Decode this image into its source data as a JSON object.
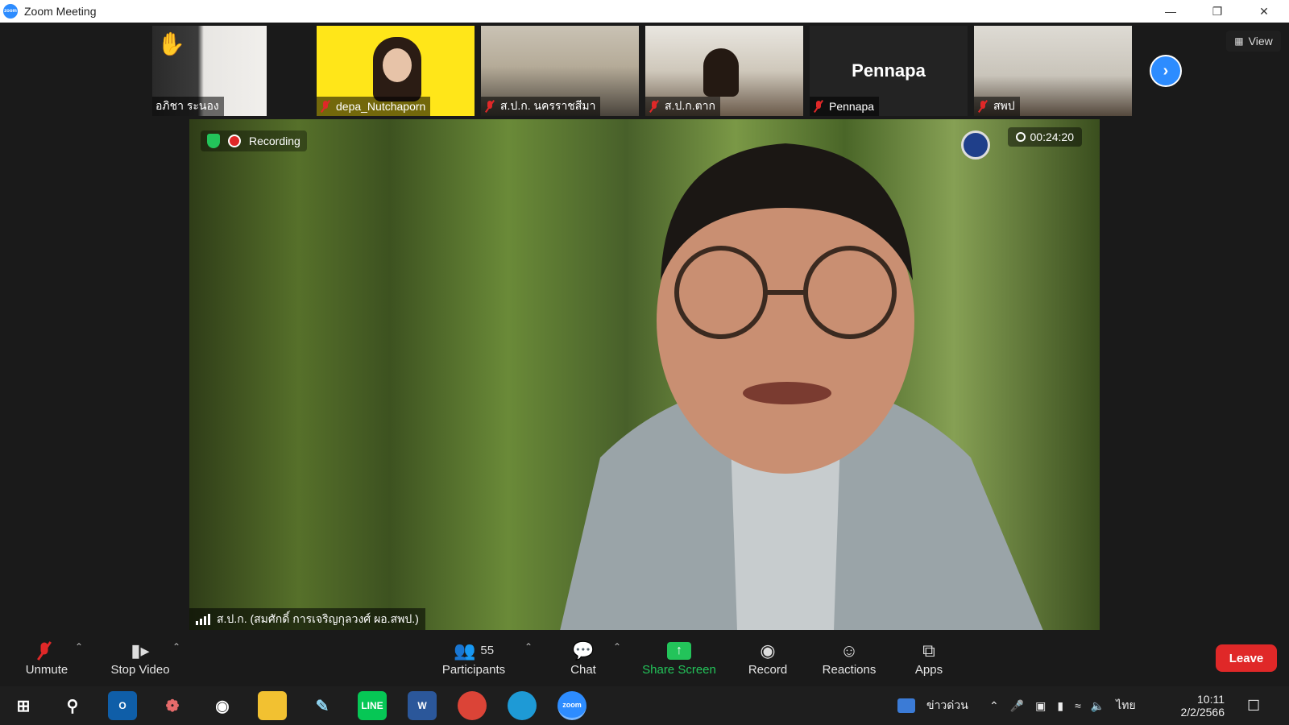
{
  "window": {
    "title": "Zoom Meeting",
    "app_icon_text": "zoom"
  },
  "view_button": {
    "label": "View"
  },
  "thumbnails": [
    {
      "name": "อภิชา ระนอง",
      "muted": false,
      "hand_raised": true
    },
    {
      "name": "depa_Nutchaporn",
      "muted": true
    },
    {
      "name": "ส.ป.ก. นครราชสีมา",
      "muted": true
    },
    {
      "name": "ส.ป.ก.ตาก",
      "muted": true
    },
    {
      "name": "Pennapa",
      "muted": true,
      "video_off": true,
      "center_label": "Pennapa"
    },
    {
      "name": "สพป",
      "muted": true
    }
  ],
  "main": {
    "recording_label": "Recording",
    "timer": "00:24:20",
    "speaker_name": "ส.ป.ก. (สมศักดิ์ การเจริญกุลวงศ์ ผอ.สพป.)"
  },
  "toolbar": {
    "unmute": "Unmute",
    "stop_video": "Stop Video",
    "participants": "Participants",
    "participants_count": "55",
    "chat": "Chat",
    "share_screen": "Share Screen",
    "record": "Record",
    "reactions": "Reactions",
    "apps": "Apps",
    "leave": "Leave"
  },
  "taskbar": {
    "news_label": "ข่าวด่วน",
    "language": "ไทย",
    "time": "10:11",
    "date": "2/2/2566",
    "zoom_app_text": "zoom"
  },
  "colors": {
    "zoom_blue": "#2d8cff",
    "leave_red": "#e02828",
    "share_green": "#23c45a",
    "muted_red": "#e02828"
  }
}
